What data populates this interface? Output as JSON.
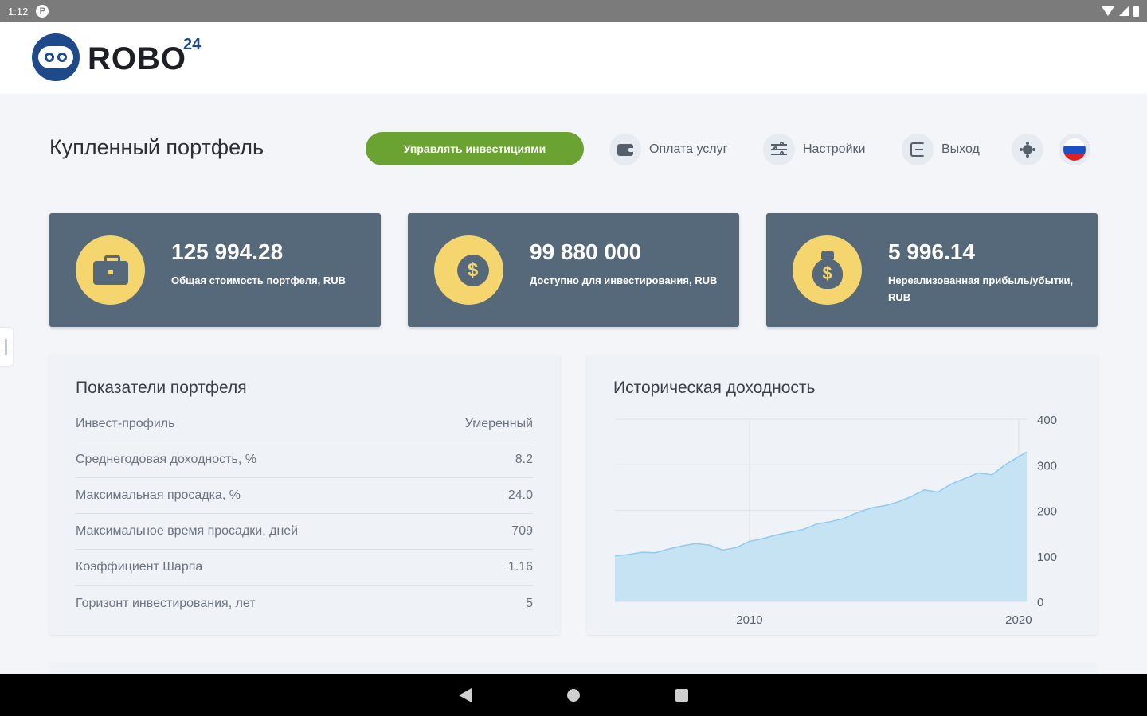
{
  "status_bar": {
    "time": "1:12",
    "notification_icon": "P"
  },
  "brand": {
    "name": "ROBO",
    "superscript": "24"
  },
  "page": {
    "title": "Купленный портфель"
  },
  "actions": {
    "manage_label": "Управлять инвестициями",
    "payment_label": "Оплата услуг",
    "settings_label": "Настройки",
    "logout_label": "Выход"
  },
  "stats": [
    {
      "value": "125 994.28",
      "label": "Общая стоимость портфеля, RUB",
      "icon": "briefcase-icon"
    },
    {
      "value": "99 880 000",
      "label": "Доступно для инвестирования, RUB",
      "icon": "coin-icon"
    },
    {
      "value": "5 996.14",
      "label": "Нереализованная прибыль/убытки, RUB",
      "icon": "money-bag-icon"
    }
  ],
  "metrics": {
    "title": "Показатели портфеля",
    "rows": [
      {
        "label": "Инвест-профиль",
        "value": "Умеренный"
      },
      {
        "label": "Среднегодовая доходность, %",
        "value": "8.2"
      },
      {
        "label": "Максимальная просадка, %",
        "value": "24.0"
      },
      {
        "label": "Максимальное время просадки, дней",
        "value": "709"
      },
      {
        "label": "Коэффициент Шарпа",
        "value": "1.16"
      },
      {
        "label": "Горизонт инвестирования, лет",
        "value": "5"
      }
    ]
  },
  "colors": {
    "accent_green": "#6aa332",
    "card_bg": "#56697a",
    "icon_yellow": "#f5d66e",
    "area_fill": "#c5e3f3",
    "area_line": "#8fcaf0",
    "flag_white": "#ffffff",
    "flag_blue": "#1f4fc4",
    "flag_red": "#e02020"
  },
  "chart_data": {
    "type": "area",
    "title": "Историческая доходность",
    "x": [
      2005.0,
      2005.5,
      2006.0,
      2006.5,
      2007.0,
      2007.5,
      2008.0,
      2008.5,
      2009.0,
      2009.5,
      2010.0,
      2010.5,
      2011.0,
      2011.5,
      2012.0,
      2012.5,
      2013.0,
      2013.5,
      2014.0,
      2014.5,
      2015.0,
      2015.5,
      2016.0,
      2016.5,
      2017.0,
      2017.5,
      2018.0,
      2018.5,
      2019.0,
      2019.5,
      2020.0,
      2020.3
    ],
    "y": [
      100,
      103,
      108,
      107,
      115,
      122,
      127,
      124,
      113,
      118,
      132,
      138,
      146,
      152,
      158,
      170,
      175,
      182,
      195,
      205,
      210,
      218,
      230,
      245,
      240,
      258,
      270,
      282,
      278,
      300,
      318,
      328
    ],
    "xticks": [
      2010,
      2020
    ],
    "yticks": [
      0,
      100,
      200,
      300,
      400
    ],
    "xlim": [
      2005,
      2020.3
    ],
    "ylim": [
      0,
      400
    ],
    "grid": true
  }
}
